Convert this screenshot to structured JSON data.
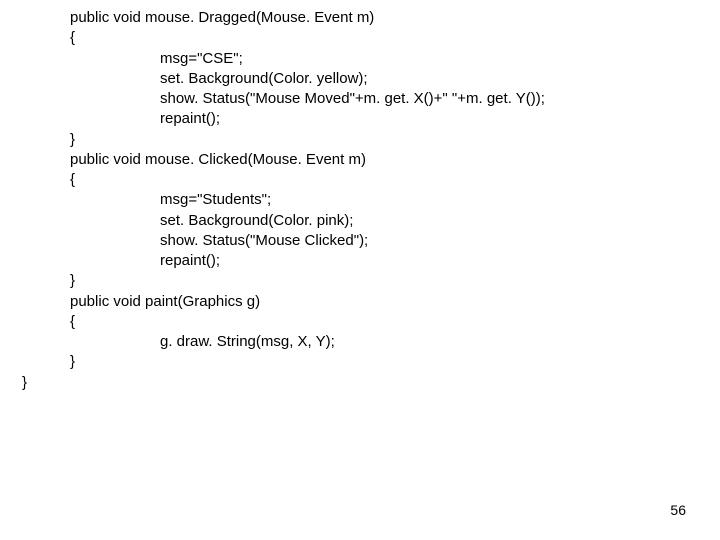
{
  "code": {
    "l01": "public void mouse. Dragged(Mouse. Event m)",
    "l02": "{",
    "l03": "msg=\"CSE\";",
    "l04": "set. Background(Color. yellow);",
    "l05": "show. Status(\"Mouse Moved\"+m. get. X()+\" \"+m. get. Y());",
    "l06": "repaint();",
    "l07": "}",
    "l08": "public void mouse. Clicked(Mouse. Event m)",
    "l09": "{",
    "l10": "msg=\"Students\";",
    "l11": "set. Background(Color. pink);",
    "l12": "show. Status(\"Mouse Clicked\");",
    "l13": "repaint();",
    "l14": "}",
    "l15": "public void paint(Graphics g)",
    "l16": "{",
    "l17": "g. draw. String(msg, X, Y);",
    "l18": "}",
    "l19": "}"
  },
  "page_number": "56"
}
